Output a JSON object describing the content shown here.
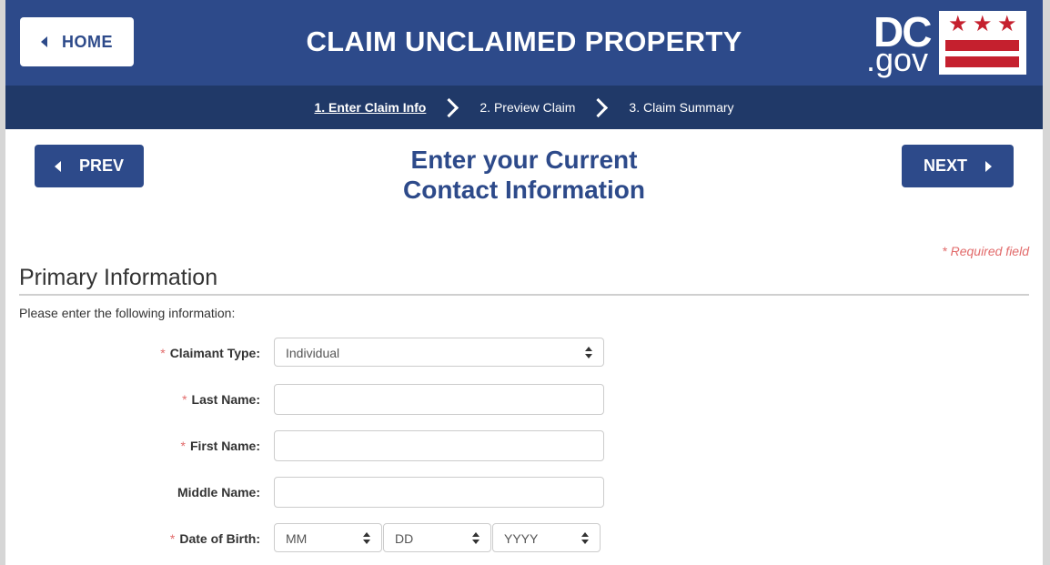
{
  "header": {
    "home_label": "HOME",
    "title": "CLAIM UNCLAIMED PROPERTY",
    "logo": {
      "dc": "DC",
      "gov": ".gov"
    }
  },
  "steps": [
    {
      "label": "1. Enter Claim Info",
      "active": true
    },
    {
      "label": "2. Preview Claim",
      "active": false
    },
    {
      "label": "3. Claim Summary",
      "active": false
    }
  ],
  "nav": {
    "prev_label": "PREV",
    "next_label": "NEXT",
    "heading_line1": "Enter your Current",
    "heading_line2": "Contact Information"
  },
  "form": {
    "required_note": "* Required field",
    "section_title": "Primary Information",
    "instructions": "Please enter the following information:",
    "claimant_type": {
      "label": "Claimant Type:",
      "required": "*",
      "value": "Individual"
    },
    "last_name": {
      "label": "Last Name:",
      "required": "*",
      "value": ""
    },
    "first_name": {
      "label": "First Name:",
      "required": "*",
      "value": ""
    },
    "middle_name": {
      "label": "Middle Name:",
      "value": ""
    },
    "dob": {
      "label": "Date of Birth:",
      "required": "*",
      "month": "MM",
      "day": "DD",
      "year": "YYYY"
    }
  },
  "colors": {
    "brand_blue": "#2d4a8a",
    "steps_bar": "#203968",
    "required_red": "#e26b6b",
    "flag_red": "#c5202e"
  }
}
